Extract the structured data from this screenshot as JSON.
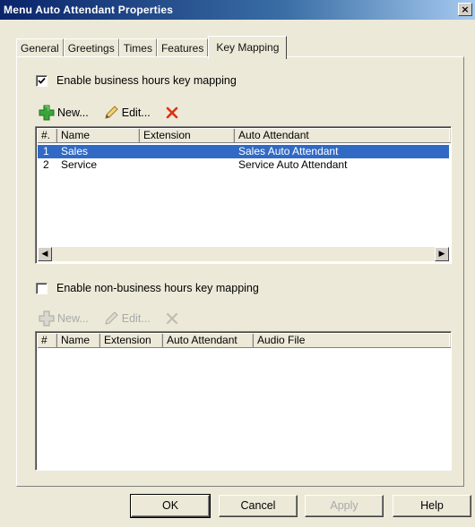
{
  "window": {
    "title": "Menu Auto Attendant Properties",
    "close_glyph": "×"
  },
  "tabs": [
    "General",
    "Greetings",
    "Times",
    "Features",
    "Key Mapping"
  ],
  "active_tab": "Key Mapping",
  "business": {
    "enable_label": "Enable business hours key mapping",
    "checked": true,
    "toolbar": {
      "new_label": "New...",
      "edit_label": "Edit...",
      "new_icon": "add-icon",
      "edit_icon": "pencil-icon",
      "delete_icon": "delete-x-icon"
    },
    "columns": [
      "#.",
      "Name",
      "Extension",
      "Auto Attendant"
    ],
    "rows": [
      {
        "num": "1",
        "name": "Sales",
        "extension": "",
        "auto_attendant": "Sales Auto Attendant",
        "selected": true
      },
      {
        "num": "2",
        "name": "Service",
        "extension": "",
        "auto_attendant": "Service Auto Attendant",
        "selected": false
      }
    ]
  },
  "non_business": {
    "enable_label": "Enable non-business hours key mapping",
    "checked": false,
    "toolbar": {
      "new_label": "New...",
      "edit_label": "Edit..."
    },
    "columns": [
      "#",
      "Name",
      "Extension",
      "Auto Attendant",
      "Audio File"
    ]
  },
  "buttons": {
    "ok": "OK",
    "cancel": "Cancel",
    "apply": "Apply",
    "help": "Help"
  },
  "colors": {
    "selection": "#316ac5",
    "add_icon": "#3aa63a",
    "delete_icon": "#e03010"
  }
}
